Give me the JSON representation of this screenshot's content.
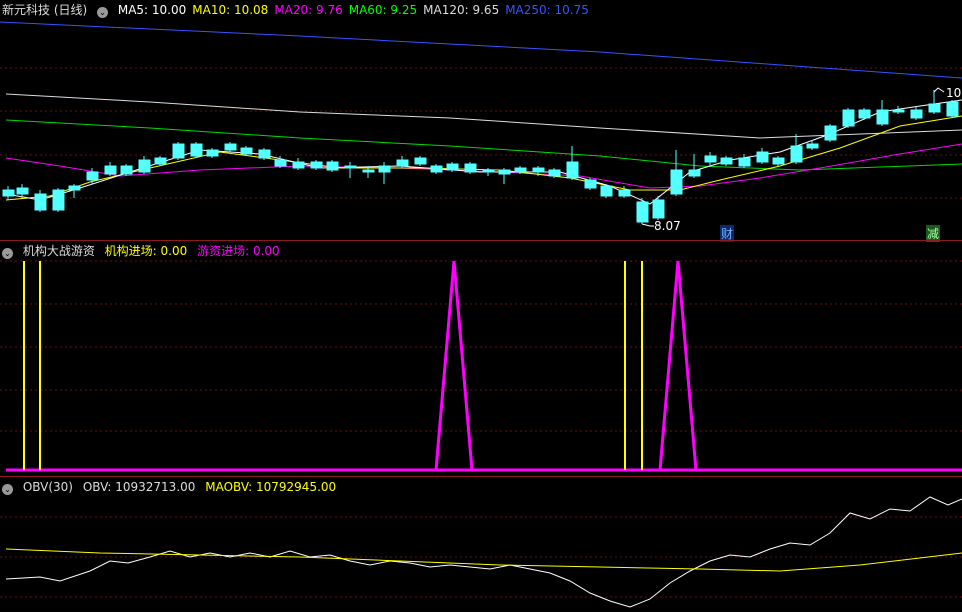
{
  "main": {
    "title": "新元科技 (日线)",
    "ma": [
      {
        "label": "MA5:",
        "value": "10.00",
        "color": "#ffffff"
      },
      {
        "label": "MA10:",
        "value": "10.08",
        "color": "#ffff00"
      },
      {
        "label": "MA20:",
        "value": "9.76",
        "color": "#ff00ff"
      },
      {
        "label": "MA60:",
        "value": "9.25",
        "color": "#00ff00"
      },
      {
        "label": "MA120:",
        "value": "9.65",
        "color": "#dcdcdc"
      },
      {
        "label": "MA250:",
        "value": "10.75",
        "color": "#3355ff"
      }
    ],
    "low_label": "8.07",
    "high_label": "10",
    "event_cai": "财",
    "event_jian": "减"
  },
  "ind1": {
    "name": "机构大战游资",
    "l1": "机构进场:",
    "v1": "0.00",
    "l2": "游资进场:",
    "v2": "0.00"
  },
  "ind2": {
    "name": "OBV(30)",
    "l1": "OBV:",
    "v1": "10932713.00",
    "l2": "MAOBV:",
    "v2": "10792945.00"
  },
  "colors": {
    "up": "#ff3b3b",
    "down": "#54ffff",
    "separator": "#8b1a1a",
    "grid": "#6a1010",
    "yellow": "#ffff00",
    "magenta": "#ff00ff"
  }
}
